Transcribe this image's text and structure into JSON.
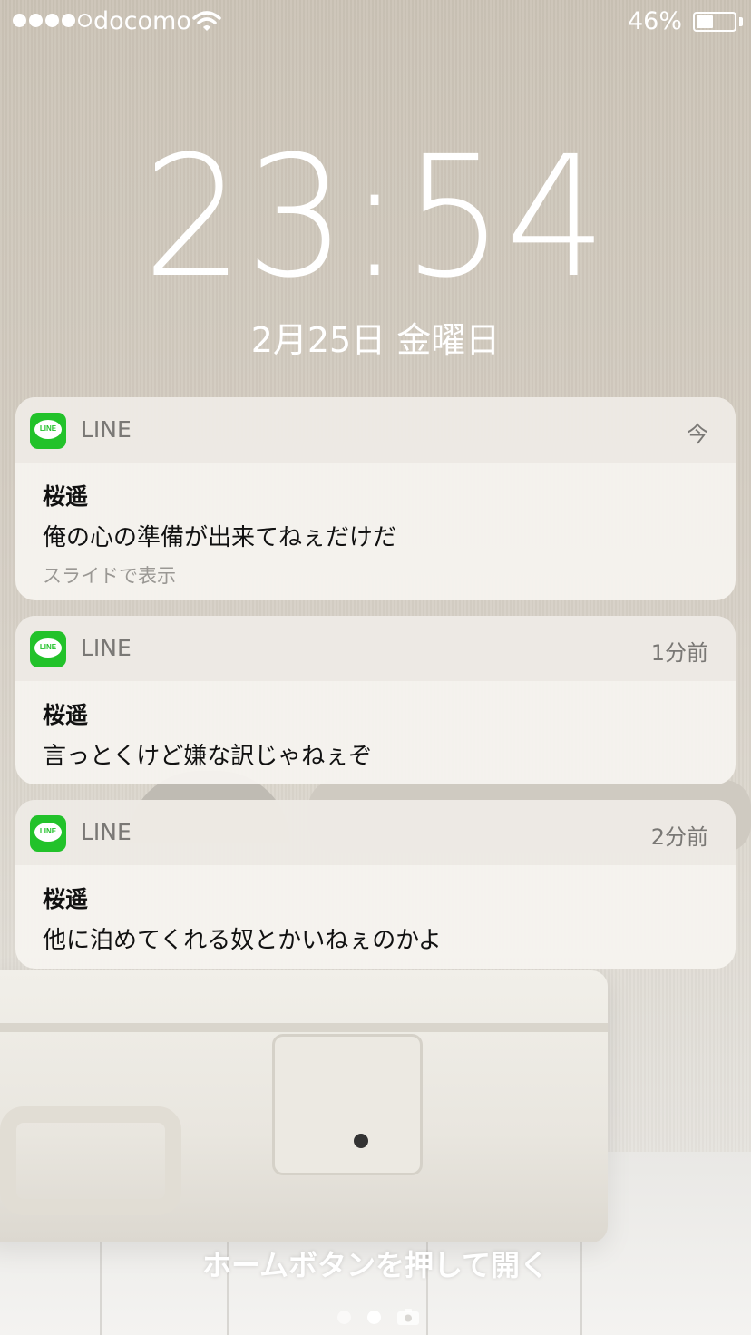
{
  "status_bar": {
    "carrier": "docomo",
    "battery_percent": "46%",
    "battery_level": 0.46,
    "signal_bars_filled": 4,
    "signal_bars_total": 5
  },
  "lock": {
    "time": "23:54",
    "date": "2月25日 金曜日"
  },
  "notifications": [
    {
      "app": "LINE",
      "time": "今",
      "sender": "桜遥",
      "message": "俺の心の準備が出来てねぇだけだ",
      "hint": "スライドで表示"
    },
    {
      "app": "LINE",
      "time": "1分前",
      "sender": "桜遥",
      "message": "言っとくけど嫌な訳じゃねぇぞ"
    },
    {
      "app": "LINE",
      "time": "2分前",
      "sender": "桜遥",
      "message": "他に泊めてくれる奴とかいねぇのかよ"
    }
  ],
  "app_icon_text": "LINE",
  "bottom": {
    "unlock_hint": "ホームボタンを押して開く"
  },
  "colors": {
    "line_green": "#22c22a",
    "text_dark": "#111111",
    "text_muted": "#7a7875"
  },
  "icons": [
    "wifi-icon",
    "battery-icon",
    "line-app-icon",
    "camera-icon"
  ]
}
